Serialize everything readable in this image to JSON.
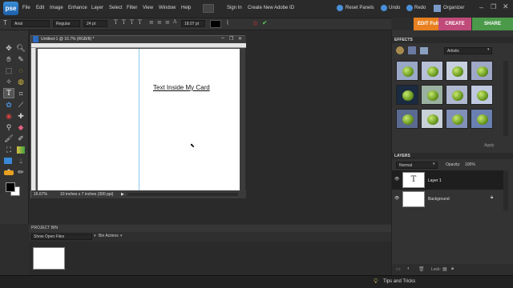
{
  "app": {
    "logo": "pse",
    "menus": [
      "File",
      "Edit",
      "Image",
      "Enhance",
      "Layer",
      "Select",
      "Filter",
      "View",
      "Window",
      "Help"
    ],
    "sign_in": "Sign In",
    "create_id": "Create New Adobe ID",
    "reset_panels": "Reset Panels",
    "undo": "Undo",
    "redo": "Redo",
    "organizer": "Organizer"
  },
  "options": {
    "font": "Arial",
    "style": "Regular",
    "size": "24 pt",
    "leading": "18.07 pt"
  },
  "modes": {
    "edit": "EDIT Full",
    "create": "CREATE",
    "share": "SHARE"
  },
  "document": {
    "title": "Untitled-1 @ 16.7% (RGB/8) *",
    "card_text": "Text Inside My Card",
    "zoom": "16.67%",
    "size_info": "10 inches x 7 inches (300 ppi)"
  },
  "bin": {
    "title": "PROJECT BIN",
    "show": "Show Open Files",
    "actions": "Bin Actions"
  },
  "effects": {
    "title": "EFFECTS",
    "category": "Artistic",
    "apply": "Apply"
  },
  "layers": {
    "title": "LAYERS",
    "mode": "Normal",
    "opacity_label": "Opacity:",
    "opacity": "100%",
    "lock": "Lock:",
    "items": [
      {
        "name": "Layer 1"
      },
      {
        "name": "Background"
      }
    ]
  },
  "footer": {
    "tips": "Tips and Tricks"
  }
}
